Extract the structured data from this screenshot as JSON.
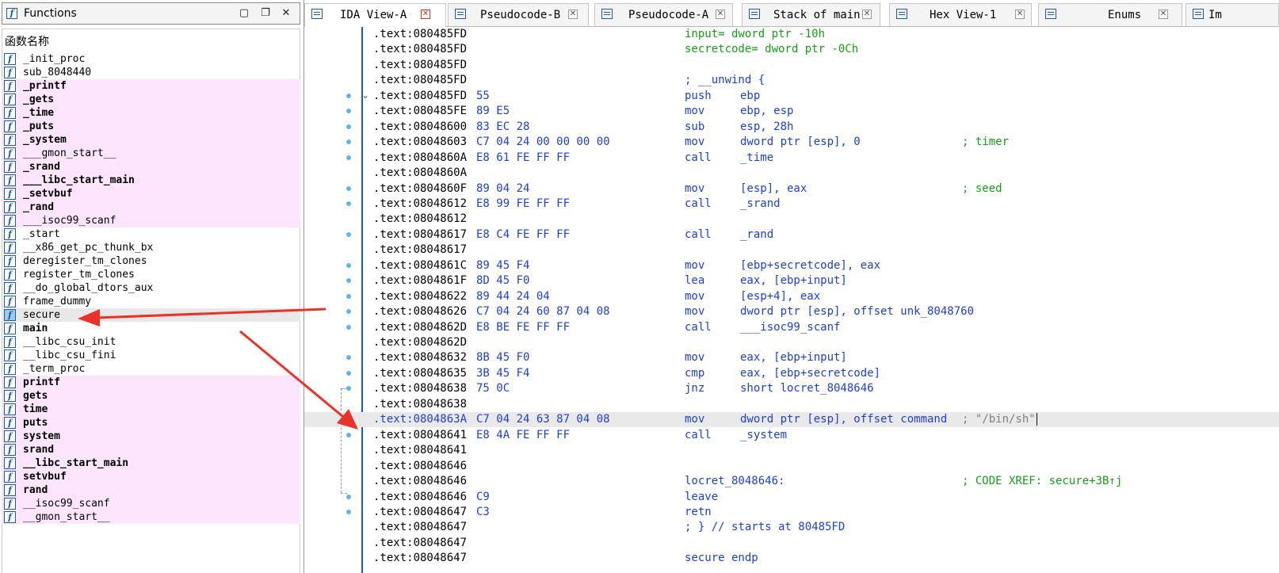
{
  "functions_panel": {
    "title": "Functions",
    "column_header": "函数名称",
    "items": [
      {
        "name": "_init_proc",
        "style": "normal"
      },
      {
        "name": "sub_8048440",
        "style": "normal"
      },
      {
        "name": "_printf",
        "style": "pink-bold"
      },
      {
        "name": "_gets",
        "style": "pink-bold"
      },
      {
        "name": "_time",
        "style": "pink-bold"
      },
      {
        "name": "_puts",
        "style": "pink-bold"
      },
      {
        "name": "_system",
        "style": "pink-bold"
      },
      {
        "name": "___gmon_start__",
        "style": "pink"
      },
      {
        "name": "_srand",
        "style": "pink-bold"
      },
      {
        "name": "___libc_start_main",
        "style": "pink-bold"
      },
      {
        "name": "_setvbuf",
        "style": "pink-bold"
      },
      {
        "name": "_rand",
        "style": "pink-bold"
      },
      {
        "name": "___isoc99_scanf",
        "style": "pink"
      },
      {
        "name": "_start",
        "style": "normal"
      },
      {
        "name": "__x86_get_pc_thunk_bx",
        "style": "normal"
      },
      {
        "name": "deregister_tm_clones",
        "style": "normal"
      },
      {
        "name": "register_tm_clones",
        "style": "normal"
      },
      {
        "name": "__do_global_dtors_aux",
        "style": "normal"
      },
      {
        "name": "frame_dummy",
        "style": "normal"
      },
      {
        "name": "secure",
        "style": "selected"
      },
      {
        "name": "main",
        "style": "bold"
      },
      {
        "name": "__libc_csu_init",
        "style": "normal"
      },
      {
        "name": "__libc_csu_fini",
        "style": "normal"
      },
      {
        "name": "_term_proc",
        "style": "normal"
      },
      {
        "name": "printf",
        "style": "pink-bold"
      },
      {
        "name": "gets",
        "style": "pink-bold"
      },
      {
        "name": "time",
        "style": "pink-bold"
      },
      {
        "name": "puts",
        "style": "pink-bold"
      },
      {
        "name": "system",
        "style": "pink-bold"
      },
      {
        "name": "srand",
        "style": "pink-bold"
      },
      {
        "name": "__libc_start_main",
        "style": "pink-bold"
      },
      {
        "name": "setvbuf",
        "style": "pink-bold"
      },
      {
        "name": "rand",
        "style": "pink-bold"
      },
      {
        "name": "__isoc99_scanf",
        "style": "pink"
      },
      {
        "name": "__gmon_start__",
        "style": "pink"
      }
    ]
  },
  "tabs": [
    {
      "label": "IDA View-A",
      "active": true
    },
    {
      "label": "Pseudocode-B",
      "active": false
    },
    {
      "label": "Pseudocode-A",
      "active": false
    },
    {
      "label": "Stack of main",
      "active": false
    },
    {
      "label": "Hex View-1",
      "active": false
    },
    {
      "label": "Enums",
      "active": false
    },
    {
      "label": "Im",
      "active": false
    }
  ],
  "disassembly": [
    {
      "addr": ".text:080485FD",
      "bytes": "",
      "mnem": "",
      "ops": "input= dword ptr -10h",
      "ops_green": true,
      "cmt": ""
    },
    {
      "addr": ".text:080485FD",
      "bytes": "",
      "mnem": "",
      "ops": "secretcode= dword ptr -0Ch",
      "ops_green": true,
      "cmt": ""
    },
    {
      "addr": ".text:080485FD",
      "bytes": "",
      "mnem": "",
      "ops": "",
      "cmt": ""
    },
    {
      "addr": ".text:080485FD",
      "bytes": "",
      "mnem": "; __unwind {",
      "ops": "",
      "cmt": ""
    },
    {
      "addr": ".text:080485FD",
      "bytes": "55",
      "mnem": "push",
      "ops": "ebp",
      "cmt": "",
      "dot": true,
      "fold": true
    },
    {
      "addr": ".text:080485FE",
      "bytes": "89 E5",
      "mnem": "mov",
      "ops": "ebp, esp",
      "cmt": "",
      "dot": true
    },
    {
      "addr": ".text:08048600",
      "bytes": "83 EC 28",
      "mnem": "sub",
      "ops": "esp, 28h",
      "cmt": "",
      "dot": true
    },
    {
      "addr": ".text:08048603",
      "bytes": "C7 04 24 00 00 00 00",
      "mnem": "mov",
      "ops": "dword ptr [esp], 0",
      "cmt": "; timer",
      "dot": true
    },
    {
      "addr": ".text:0804860A",
      "bytes": "E8 61 FE FF FF",
      "mnem": "call",
      "ops": "_time",
      "cmt": "",
      "dot": true
    },
    {
      "addr": ".text:0804860A",
      "bytes": "",
      "mnem": "",
      "ops": "",
      "cmt": ""
    },
    {
      "addr": ".text:0804860F",
      "bytes": "89 04 24",
      "mnem": "mov",
      "ops": "[esp], eax",
      "cmt": "; seed",
      "dot": true
    },
    {
      "addr": ".text:08048612",
      "bytes": "E8 99 FE FF FF",
      "mnem": "call",
      "ops": "_srand",
      "cmt": "",
      "dot": true
    },
    {
      "addr": ".text:08048612",
      "bytes": "",
      "mnem": "",
      "ops": "",
      "cmt": ""
    },
    {
      "addr": ".text:08048617",
      "bytes": "E8 C4 FE FF FF",
      "mnem": "call",
      "ops": "_rand",
      "cmt": "",
      "dot": true
    },
    {
      "addr": ".text:08048617",
      "bytes": "",
      "mnem": "",
      "ops": "",
      "cmt": ""
    },
    {
      "addr": ".text:0804861C",
      "bytes": "89 45 F4",
      "mnem": "mov",
      "ops": "[ebp+secretcode], eax",
      "cmt": "",
      "dot": true
    },
    {
      "addr": ".text:0804861F",
      "bytes": "8D 45 F0",
      "mnem": "lea",
      "ops": "eax, [ebp+input]",
      "cmt": "",
      "dot": true
    },
    {
      "addr": ".text:08048622",
      "bytes": "89 44 24 04",
      "mnem": "mov",
      "ops": "[esp+4], eax",
      "cmt": "",
      "dot": true
    },
    {
      "addr": ".text:08048626",
      "bytes": "C7 04 24 60 87 04 08",
      "mnem": "mov",
      "ops": "dword ptr [esp], offset unk_8048760",
      "cmt": "",
      "dot": true
    },
    {
      "addr": ".text:0804862D",
      "bytes": "E8 BE FE FF FF",
      "mnem": "call",
      "ops": "___isoc99_scanf",
      "cmt": "",
      "dot": true
    },
    {
      "addr": ".text:0804862D",
      "bytes": "",
      "mnem": "",
      "ops": "",
      "cmt": ""
    },
    {
      "addr": ".text:08048632",
      "bytes": "8B 45 F0",
      "mnem": "mov",
      "ops": "eax, [ebp+input]",
      "cmt": "",
      "dot": true
    },
    {
      "addr": ".text:08048635",
      "bytes": "3B 45 F4",
      "mnem": "cmp",
      "ops": "eax, [ebp+secretcode]",
      "cmt": "",
      "dot": true
    },
    {
      "addr": ".text:08048638",
      "bytes": "75 0C",
      "mnem": "jnz",
      "ops": "short locret_8048646",
      "cmt": "",
      "dot": true
    },
    {
      "addr": ".text:08048638",
      "bytes": "",
      "mnem": "",
      "ops": "",
      "cmt": ""
    },
    {
      "addr": ".text:0804863A",
      "bytes": "C7 04 24 63 87 04 08",
      "mnem": "mov",
      "ops": "dword ptr [esp], offset command",
      "cmt": "; \"/bin/sh\"",
      "dot": true,
      "highlight": true
    },
    {
      "addr": ".text:08048641",
      "bytes": "E8 4A FE FF FF",
      "mnem": "call",
      "ops": "_system",
      "cmt": "",
      "dot": true
    },
    {
      "addr": ".text:08048641",
      "bytes": "",
      "mnem": "",
      "ops": "",
      "cmt": ""
    },
    {
      "addr": ".text:08048646",
      "bytes": "",
      "mnem": "",
      "ops": "",
      "cmt": ""
    },
    {
      "addr": ".text:08048646",
      "bytes": "",
      "mnem": "locret_8048646:",
      "ops": "",
      "cmt": "; CODE XREF: secure+3B↑j"
    },
    {
      "addr": ".text:08048646",
      "bytes": "C9",
      "mnem": "leave",
      "ops": "",
      "cmt": "",
      "dot": true
    },
    {
      "addr": ".text:08048647",
      "bytes": "C3",
      "mnem": "retn",
      "ops": "",
      "cmt": "",
      "dot": true
    },
    {
      "addr": ".text:08048647",
      "bytes": "",
      "mnem": "; } // starts at 80485FD",
      "ops": "",
      "cmt": ""
    },
    {
      "addr": ".text:08048647",
      "bytes": "",
      "mnem": "",
      "ops": "",
      "cmt": ""
    },
    {
      "addr": ".text:08048647",
      "bytes": "",
      "mnem": "secure endp",
      "ops": "",
      "cmt": ""
    }
  ],
  "colors": {
    "pink_row": "#fde6fd",
    "selected_row": "#e8e8e8",
    "code_blue": "#1e3fd0",
    "comment_green": "#1a9a1a",
    "gutter_dot": "#5fb6e6",
    "annotation_arrow": "#e8332a"
  }
}
